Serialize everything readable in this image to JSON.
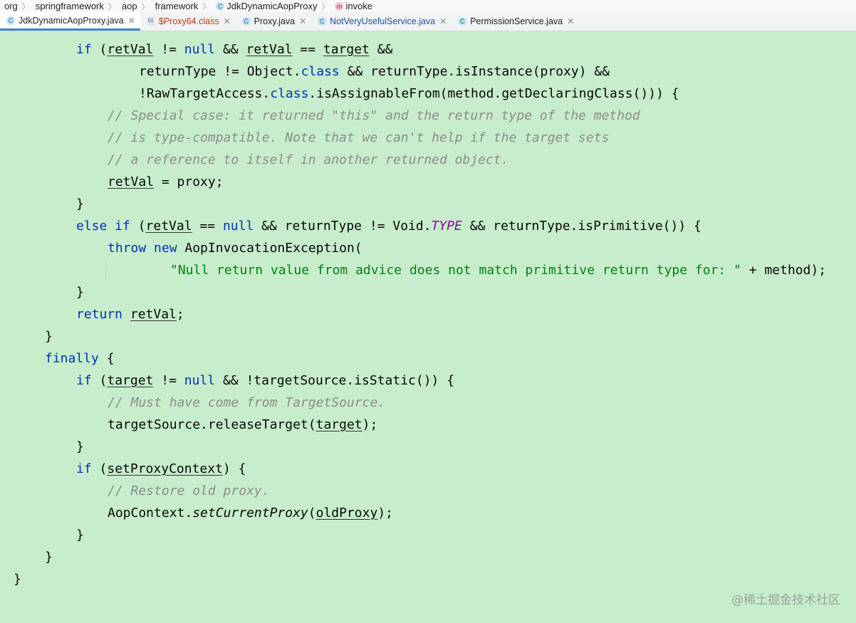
{
  "breadcrumb": {
    "items": [
      "org",
      "springframework",
      "aop",
      "framework",
      "JdkDynamicAopProxy",
      "invoke"
    ],
    "icons": [
      "class-icon",
      "method-icon"
    ]
  },
  "tabs": [
    {
      "label": "JdkDynamicAopProxy.java",
      "icon": "class-icon",
      "active": true
    },
    {
      "label": "$Proxy64.class",
      "icon": "binary-class-icon",
      "active": false
    },
    {
      "label": "Proxy.java",
      "icon": "class-icon",
      "active": false
    },
    {
      "label": "NotVeryUsefulService.java",
      "icon": "class-icon",
      "active": false
    },
    {
      "label": "PermissionService.java",
      "icon": "class-icon",
      "active": false
    }
  ],
  "colors": {
    "editor_background": "#c7edcc",
    "keyword": "#0033b3",
    "comment": "#8c8c8c",
    "string": "#067d17",
    "static_field": "#871094",
    "active_tab_underline": "#4083c9"
  },
  "code": {
    "l1": {
      "p1": "if",
      "p2": " (",
      "p3": "retVal",
      "p4": " != ",
      "p5": "null",
      "p6": " && ",
      "p7": "retVal",
      "p8": " == ",
      "p9": "target",
      "p10": " &&"
    },
    "l2": {
      "p1": "returnType != Object.",
      "p2": "class",
      "p3": " && returnType.isInstance(proxy) &&"
    },
    "l3": {
      "p1": "!RawTargetAccess.",
      "p2": "class",
      "p3": ".isAssignableFrom(method.getDeclaringClass())) {"
    },
    "l4": "// Special case: it returned \"this\" and the return type of the method",
    "l5": "// is type-compatible. Note that we can't help if the target sets",
    "l6": "// a reference to itself in another returned object.",
    "l7": {
      "p1": "retVal",
      "p2": " = proxy;"
    },
    "l8": "}",
    "l9": {
      "p1": "else if",
      "p2": " (",
      "p3": "retVal",
      "p4": " == ",
      "p5": "null",
      "p6": " && returnType != Void.",
      "p7": "TYPE",
      "p8": " && returnType.isPrimitive()) {"
    },
    "l10": {
      "p1": "throw new",
      "p2": " AopInvocationException("
    },
    "l11": {
      "p1": "\"Null return value from advice does not match primitive return type for: \"",
      "p2": " + method);"
    },
    "l12": "}",
    "l13": {
      "p1": "return",
      "p2": " ",
      "p3": "retVal",
      "p4": ";"
    },
    "l14": "}",
    "l15": {
      "p1": "finally",
      "p2": " {"
    },
    "l16": {
      "p1": "if",
      "p2": " (",
      "p3": "target",
      "p4": " != ",
      "p5": "null",
      "p6": " && !targetSource.isStatic()) {"
    },
    "l17": "// Must have come from TargetSource.",
    "l18": {
      "p1": "targetSource.releaseTarget(",
      "p2": "target",
      "p3": ");"
    },
    "l19": "}",
    "l20": {
      "p1": "if",
      "p2": " (",
      "p3": "setProxyContext",
      "p4": ") {"
    },
    "l21": "// Restore old proxy.",
    "l22": {
      "p1": "AopContext.",
      "p2": "setCurrentProxy",
      "p3": "(",
      "p4": "oldProxy",
      "p5": ");"
    },
    "l23": "}",
    "l24": "}",
    "l25": "}"
  },
  "watermark": "@稀土掘金技术社区"
}
